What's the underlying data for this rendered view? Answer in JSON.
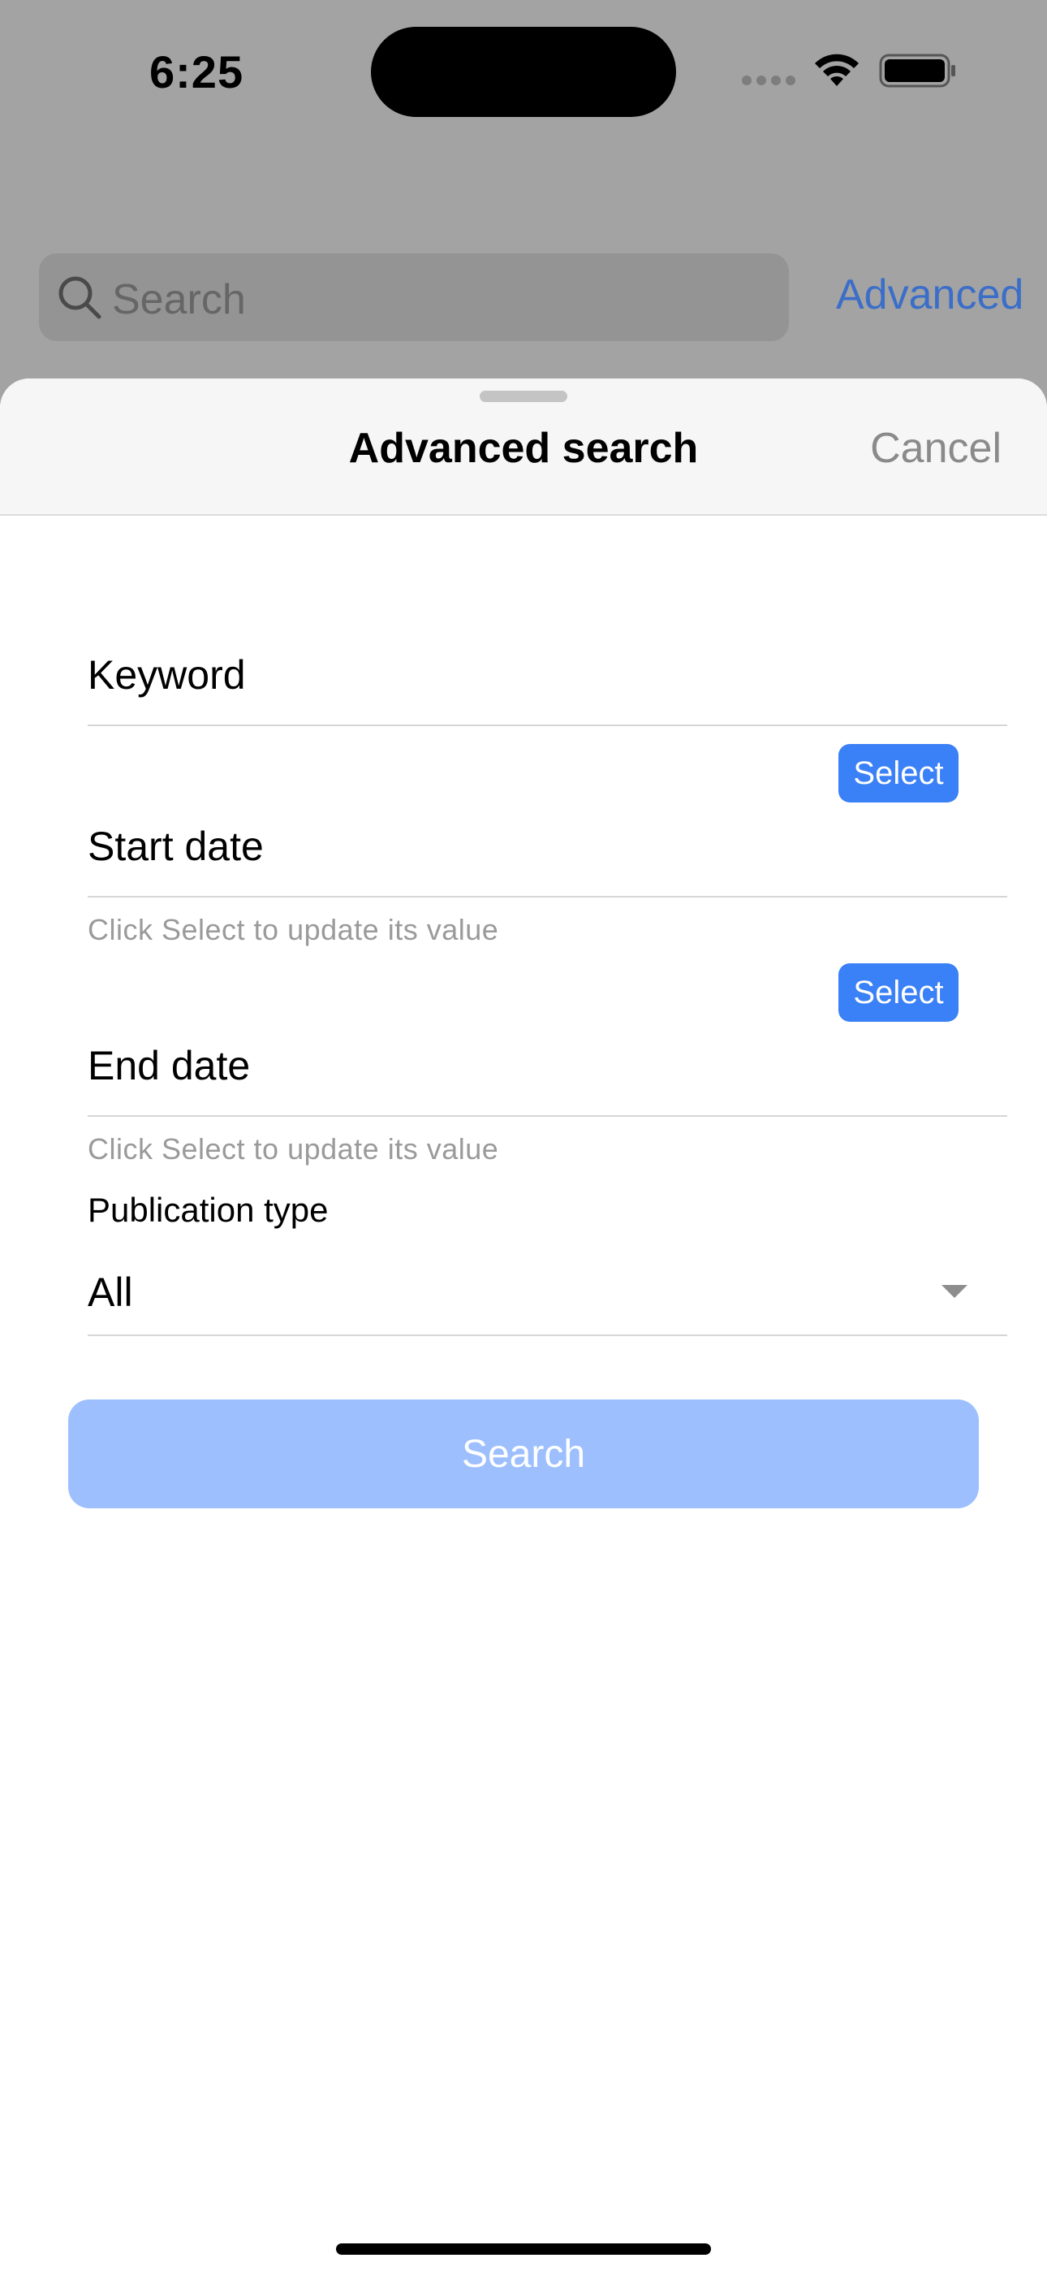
{
  "status_bar": {
    "time": "6:25"
  },
  "background": {
    "search_placeholder": "Search",
    "advanced_label": "Advanced"
  },
  "sheet": {
    "title": "Advanced search",
    "cancel_label": "Cancel",
    "keyword": {
      "label": "Keyword"
    },
    "start_date": {
      "label": "Start date",
      "select_label": "Select",
      "hint": "Click Select to update its value"
    },
    "end_date": {
      "label": "End date",
      "select_label": "Select",
      "hint": "Click Select to update its value"
    },
    "publication_type": {
      "label": "Publication type",
      "value": "All"
    },
    "search_label": "Search"
  },
  "colors": {
    "accent": "#3a80f6",
    "search_button_disabled": "#9dbffe",
    "dimmed_background": "#a3a3a3"
  }
}
